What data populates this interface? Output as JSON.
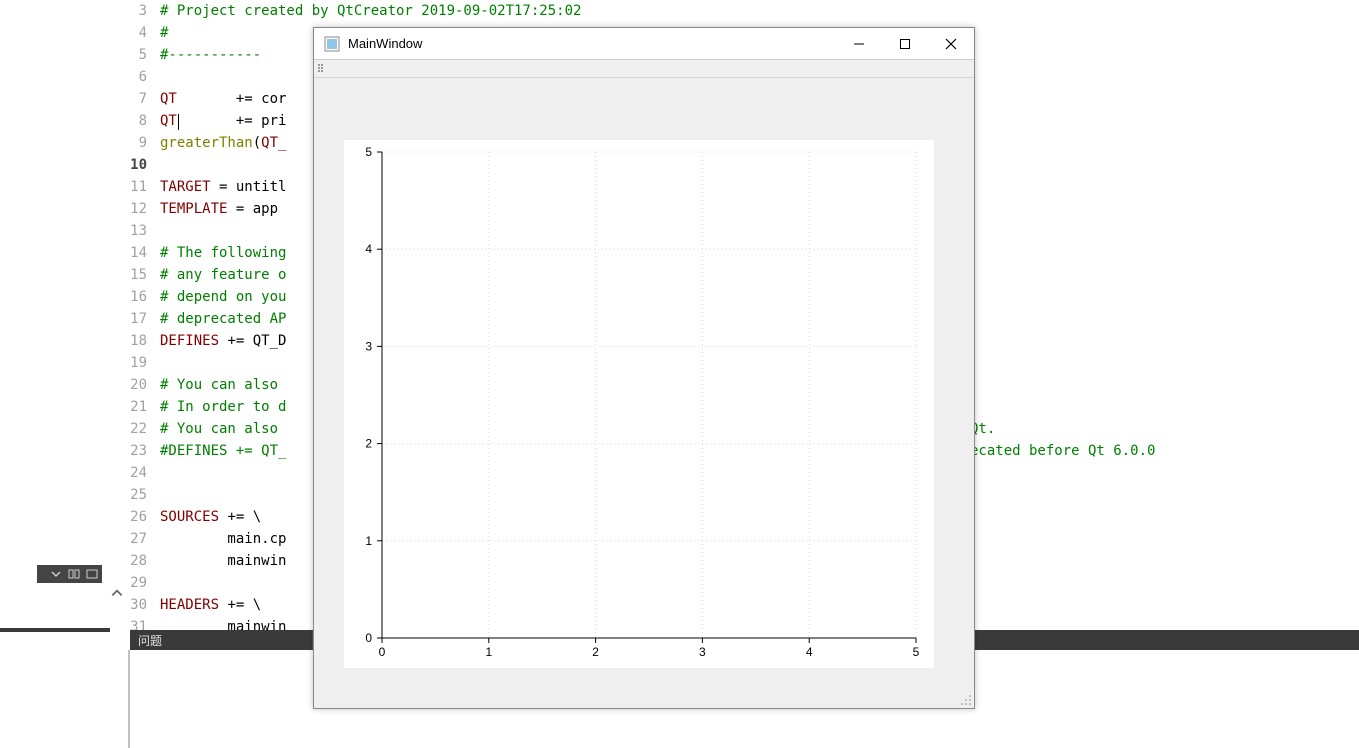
{
  "editor": {
    "start_line": 3,
    "lines": [
      {
        "n": 3,
        "segments": [
          {
            "cls": "comment",
            "t": "# Project created by QtCreator 2019-09-02T17:25:02"
          }
        ]
      },
      {
        "n": 4,
        "segments": [
          {
            "cls": "comment",
            "t": "#"
          }
        ]
      },
      {
        "n": 5,
        "segments": [
          {
            "cls": "comment",
            "t": "#-----------"
          }
        ]
      },
      {
        "n": 6,
        "segments": []
      },
      {
        "n": 7,
        "segments": [
          {
            "cls": "identifier",
            "t": "QT"
          },
          {
            "cls": "plain",
            "t": "       += cor"
          }
        ]
      },
      {
        "n": 8,
        "segments": [
          {
            "cls": "identifier",
            "t": "QT"
          },
          {
            "cls": "plain",
            "t": "       += pri"
          }
        ]
      },
      {
        "n": 9,
        "segments": [
          {
            "cls": "keyword",
            "t": "greaterThan"
          },
          {
            "cls": "plain",
            "t": "("
          },
          {
            "cls": "identifier",
            "t": "QT_"
          }
        ]
      },
      {
        "n": 10,
        "current": true,
        "segments": []
      },
      {
        "n": 11,
        "segments": [
          {
            "cls": "identifier",
            "t": "TARGET"
          },
          {
            "cls": "plain",
            "t": " = untitl"
          }
        ]
      },
      {
        "n": 12,
        "segments": [
          {
            "cls": "identifier",
            "t": "TEMPLATE"
          },
          {
            "cls": "plain",
            "t": " = app"
          }
        ]
      },
      {
        "n": 13,
        "segments": []
      },
      {
        "n": 14,
        "segments": [
          {
            "cls": "comment",
            "t": "# The following"
          }
        ]
      },
      {
        "n": 15,
        "segments": [
          {
            "cls": "comment",
            "t": "# any feature o"
          }
        ]
      },
      {
        "n": 16,
        "segments": [
          {
            "cls": "comment",
            "t": "# depend on you"
          }
        ]
      },
      {
        "n": 17,
        "segments": [
          {
            "cls": "comment",
            "t": "# deprecated AP"
          }
        ]
      },
      {
        "n": 18,
        "segments": [
          {
            "cls": "identifier",
            "t": "DEFINES"
          },
          {
            "cls": "plain",
            "t": " += QT_D"
          }
        ]
      },
      {
        "n": 19,
        "segments": []
      },
      {
        "n": 20,
        "segments": [
          {
            "cls": "comment",
            "t": "# You can also "
          }
        ]
      },
      {
        "n": 21,
        "segments": [
          {
            "cls": "comment",
            "t": "# In order to d"
          }
        ]
      },
      {
        "n": 22,
        "segments": [
          {
            "cls": "comment",
            "t": "# You can also "
          }
        ],
        "trail": {
          "cls": "comment",
          "t": "Qt."
        }
      },
      {
        "n": 23,
        "segments": [
          {
            "cls": "comment",
            "t": "#DEFINES += QT_"
          }
        ],
        "trail": {
          "cls": "comment",
          "t": "ecated before Qt 6.0.0"
        }
      },
      {
        "n": 24,
        "segments": []
      },
      {
        "n": 25,
        "segments": []
      },
      {
        "n": 26,
        "segments": [
          {
            "cls": "identifier",
            "t": "SOURCES"
          },
          {
            "cls": "plain",
            "t": " += \\"
          }
        ]
      },
      {
        "n": 27,
        "segments": [
          {
            "cls": "plain",
            "t": "        main.cp"
          }
        ]
      },
      {
        "n": 28,
        "segments": [
          {
            "cls": "plain",
            "t": "        mainwin"
          }
        ]
      },
      {
        "n": 29,
        "segments": []
      },
      {
        "n": 30,
        "segments": [
          {
            "cls": "identifier",
            "t": "HEADERS"
          },
          {
            "cls": "plain",
            "t": " += \\"
          }
        ]
      },
      {
        "n": 31,
        "segments": [
          {
            "cls": "plain",
            "t": "        mainwin"
          }
        ]
      }
    ]
  },
  "bottom_panel": {
    "label": "问题"
  },
  "window": {
    "title": "MainWindow"
  },
  "chart_data": {
    "type": "line",
    "series": [],
    "title": "",
    "xlabel": "",
    "ylabel": "",
    "xlim": [
      0,
      5
    ],
    "ylim": [
      0,
      5
    ],
    "xticks": [
      0,
      1,
      2,
      3,
      4,
      5
    ],
    "yticks": [
      0,
      1,
      2,
      3,
      4,
      5
    ],
    "grid": true
  }
}
